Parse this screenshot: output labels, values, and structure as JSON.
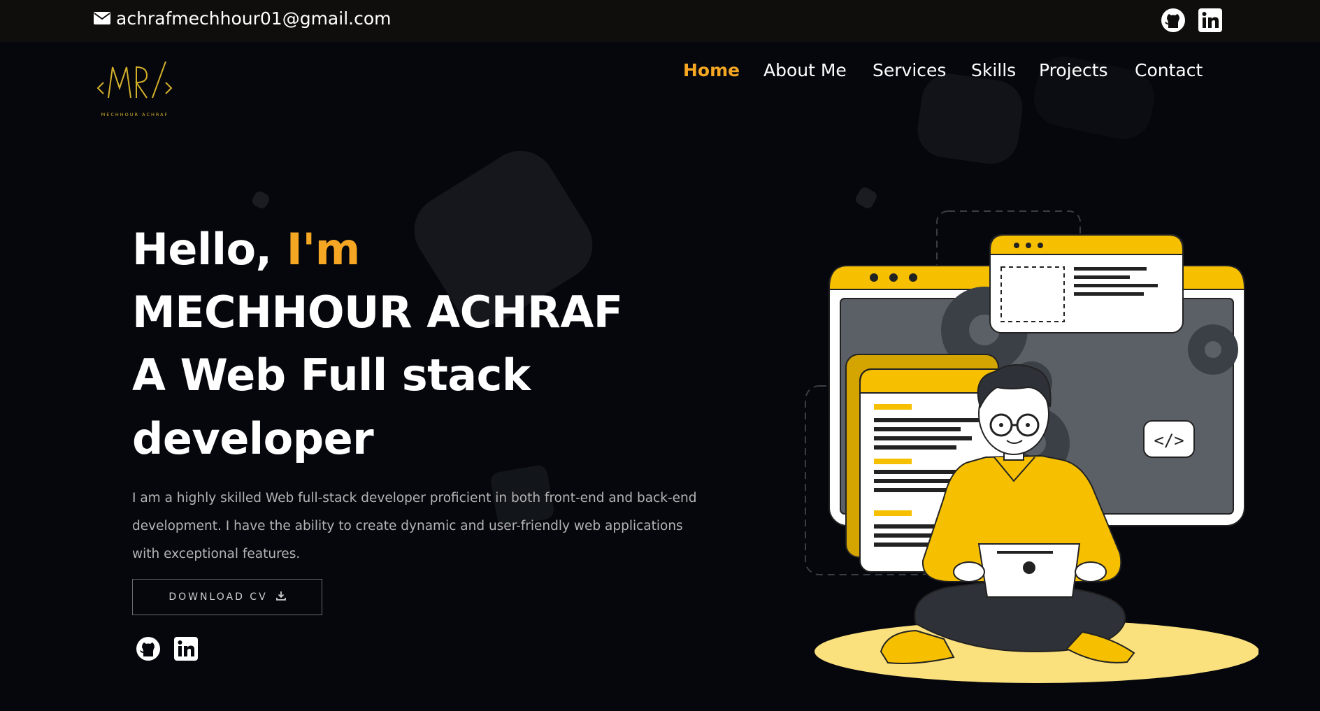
{
  "topbar": {
    "email": "achrafmechhour01@gmail.com",
    "email_icon": "envelope-icon",
    "social_icons": [
      "github-icon",
      "linkedin-icon"
    ]
  },
  "brand": {
    "logo_initials": "MR",
    "logo_text": "MECHHOUR ACHRAF",
    "accent_color": "#f5a623",
    "logo_color": "#d4b02a"
  },
  "nav": {
    "items": [
      "Home",
      "About Me",
      "Services",
      "Skills",
      "Projects",
      "Contact"
    ],
    "active": "Home"
  },
  "hero": {
    "greeting": "Hello,",
    "greeting_accent": "I'm",
    "name": "MECHHOUR ACHRAF",
    "role_line1": "A Web Full stack",
    "role_line2": "developer",
    "description": "I am a highly skilled Web full-stack developer proficient in both front-end and back-end development. I have the ability to create dynamic and user-friendly web applications with exceptional features.",
    "cv_button": "DOWNLOAD CV",
    "cv_icon": "download-icon",
    "social_icons": [
      "github-icon",
      "linkedin-icon"
    ]
  },
  "illustration": {
    "code_badge": "</>"
  }
}
